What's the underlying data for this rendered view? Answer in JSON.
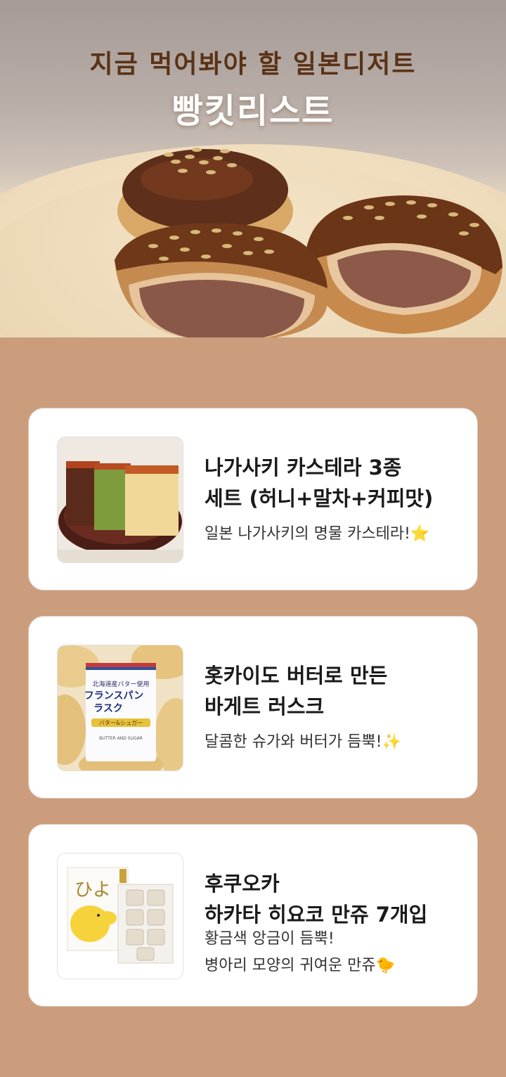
{
  "hero": {
    "title": "지금 먹어봐야 할 일본디저트",
    "subtitle": "빵킷리스트"
  },
  "colors": {
    "background": "#cc9d7c",
    "title_brown": "#5a3215",
    "card": "#ffffff"
  },
  "products": [
    {
      "title_lines": [
        "나가사키 카스테라 3종",
        "세트 (허니+말차+커피맛)"
      ],
      "desc_lines": [
        "일본 나가사키의 명물 카스테라!⭐"
      ],
      "image": "castella-photo"
    },
    {
      "title_lines": [
        "홋카이도 버터로 만든",
        "바게트 러스크"
      ],
      "desc_lines": [
        "달콤한 슈가와 버터가 듬뿍!✨"
      ],
      "image": "rusk-photo"
    },
    {
      "title_lines": [
        "후쿠오카",
        "하카타 히요코 만쥬 7개입"
      ],
      "desc_lines": [
        "황금색 앙금이 듬뿍!",
        "병아리 모양의 귀여운 만쥬🐤"
      ],
      "image": "hiyoko-photo"
    }
  ]
}
